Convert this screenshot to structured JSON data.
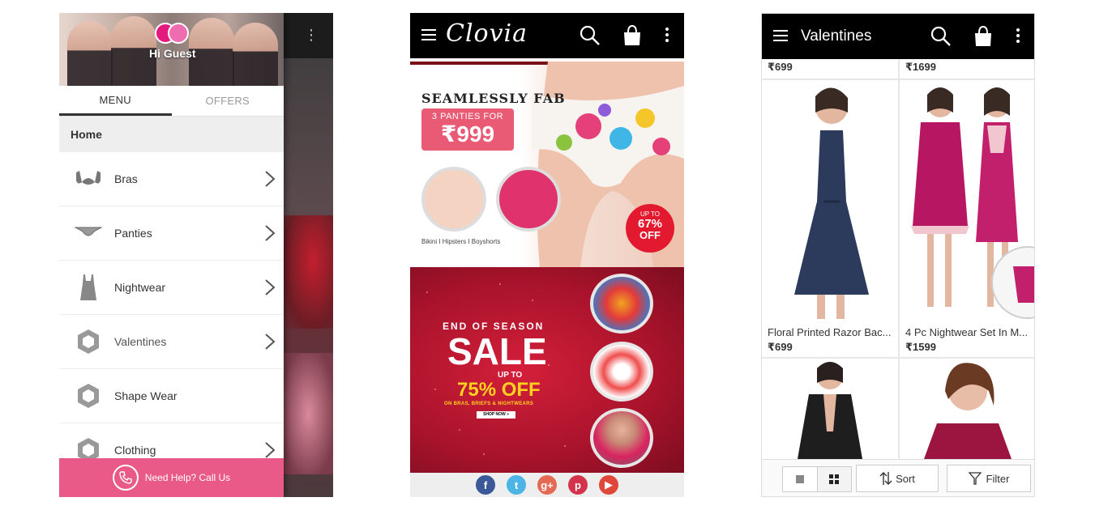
{
  "drawer": {
    "greeting": "Hi Guest",
    "tabs": [
      {
        "label": "MENU"
      },
      {
        "label": "OFFERS"
      }
    ],
    "home_label": "Home",
    "items": [
      {
        "label": "Bras",
        "icon": "bra-icon"
      },
      {
        "label": "Panties",
        "icon": "panty-icon"
      },
      {
        "label": "Nightwear",
        "icon": "nightwear-icon"
      },
      {
        "label": "Valentines",
        "icon": "hexagon-icon"
      },
      {
        "label": "Shape Wear",
        "icon": "hexagon-icon"
      },
      {
        "label": "Clothing",
        "icon": "hexagon-icon"
      }
    ],
    "help_label": "Need Help? Call Us",
    "accent": "#ea5a88"
  },
  "home": {
    "brand": "Clovia",
    "banner1": {
      "headline": "SEAMLESSLY FAB",
      "offer_top": "3 PANTIES FOR",
      "offer_price": "₹999",
      "caption": "Bikini I Hipsters I Boyshorts",
      "badge_top": "UP TO",
      "badge_pct": "67%",
      "badge_off": "OFF"
    },
    "banner2": {
      "line1": "END OF SEASON",
      "line2": "SALE",
      "line3": "UP TO",
      "line4": "75% OFF",
      "line5": "ON BRAS, BRIEFS & NIGHTWEARS",
      "cta": "SHOP NOW »"
    },
    "social": [
      "facebook-icon",
      "twitter-icon",
      "google-plus-icon",
      "pinterest-icon",
      "youtube-icon"
    ]
  },
  "listing": {
    "title": "Valentines",
    "products": [
      {
        "name": "",
        "price": "₹699"
      },
      {
        "name": "",
        "price": "₹1699"
      },
      {
        "name": "Floral Printed Razor Bac...",
        "price": "₹699"
      },
      {
        "name": "4 Pc Nightwear Set In M...",
        "price": "₹1599"
      },
      {
        "name": "",
        "price": ""
      },
      {
        "name": "",
        "price": ""
      }
    ],
    "sort_label": "Sort",
    "filter_label": "Filter"
  }
}
